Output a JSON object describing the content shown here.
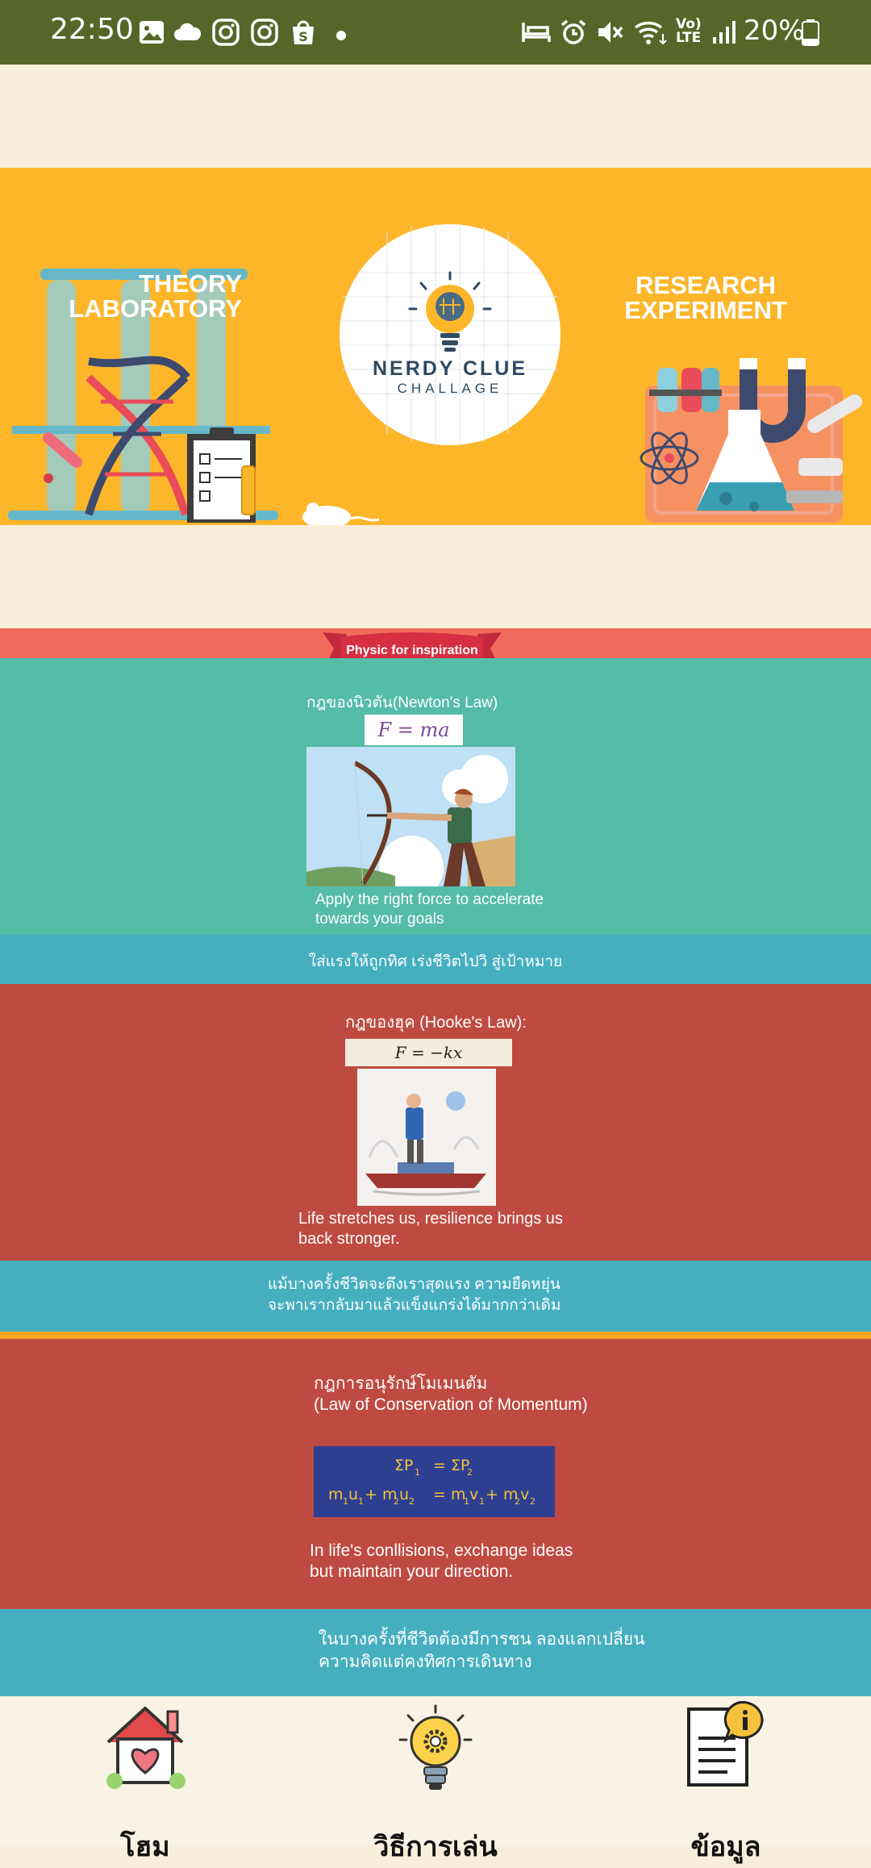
{
  "status_bar": {
    "time": "22:50",
    "battery": "20%",
    "network_label_top": "Vo)",
    "network_label_bottom": "LTE"
  },
  "banner": {
    "left_label_line1": "THEORY",
    "left_label_line2": "LABORATORY",
    "right_label_line1": "RESEARCH",
    "right_label_line2": "EXPERIMENT",
    "logo_title": "NERDY CLUE",
    "logo_subtitle": "CHALLAGE",
    "background_color": "#fdb62a"
  },
  "ribbon": {
    "label": "Physic for inspiration"
  },
  "newton": {
    "title": "กฎของนิวตัน(Newton's Law)",
    "equation": "F = ma",
    "caption_line1": "Apply the right force to accelerate",
    "caption_line2": "towards your goals",
    "band_text": "ใส่แรงให้ถูกทิศ เร่งชีวิตไปวิ สู่เป้าหมาย"
  },
  "hooke": {
    "title": "กฎของฮุค (Hooke's Law):",
    "equation": "F = −kx",
    "caption_line1": "Life stretches us, resilience brings us",
    "caption_line2": "back stronger.",
    "band_line1": "แม้บางครั้งชีวิตจะดึงเราสุดแรง ความยืดหยุ่น",
    "band_line2": "จะพาเรากลับมาแล้วแข็งแกร่งได้มากกว่าเดิม"
  },
  "momentum": {
    "title_line1": "กฎการอนุรักษ์โมเมนตัม",
    "title_line2": "(Law of Conservation of Momentum)",
    "caption_line1": "In life's conllisions, exchange ideas",
    "caption_line2": "but maintain your direction.",
    "band_line1": "ในบางครั้งที่ชีวิตต้องมีการชน ลองแลกเปลี่ยน",
    "band_line2": "ความคิดแต่คงทิศการเดินทาง"
  },
  "bottom_nav": {
    "items": [
      {
        "label": "โฮม",
        "icon": "home-icon"
      },
      {
        "label": "วิธีการเล่น",
        "icon": "lightbulb-gear-icon"
      },
      {
        "label": "ข้อมูล",
        "icon": "document-info-icon"
      }
    ]
  }
}
